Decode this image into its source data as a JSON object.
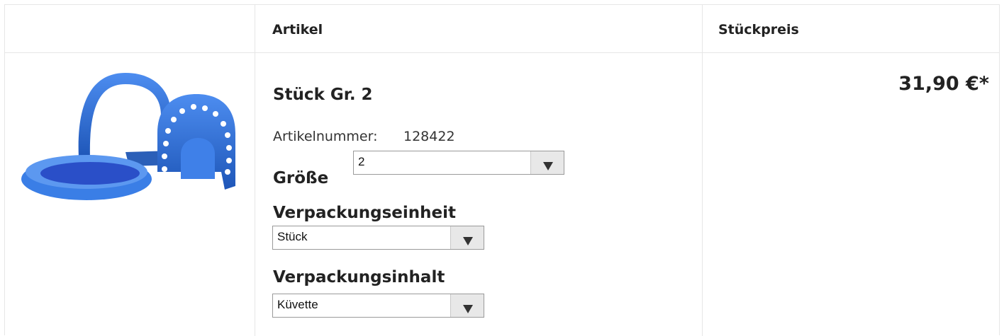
{
  "header": {
    "col_article": "Artikel",
    "col_unit_price": "Stückpreis"
  },
  "product": {
    "name": "Stück Gr. 2",
    "article_number_label": "Artikelnummer:",
    "article_number": "128422",
    "price": "31,90 €*",
    "image_icon": "dental-flask-product-image",
    "image_color": "#2f6fd8"
  },
  "options": {
    "size": {
      "label": "Größe",
      "value": "2"
    },
    "packaging_unit": {
      "label": "Verpackungseinheit",
      "value": "Stück"
    },
    "packaging_content": {
      "label": "Verpackungsinhalt",
      "value": "Küvette"
    }
  }
}
